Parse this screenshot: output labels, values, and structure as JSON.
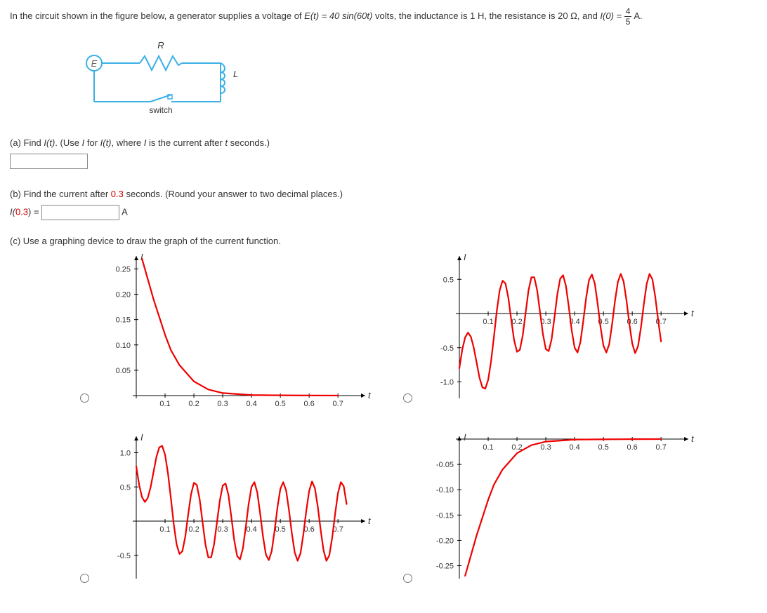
{
  "problem": {
    "intro": "In the circuit shown in the figure below, a generator supplies a voltage of ",
    "voltage_expr_left": "E(t) = 40 sin(60t)",
    "volts_text": " volts,  the inductance is 1 H, the resistance is 20 Ω, and ",
    "i0_lhs": "I(0) = ",
    "frac_num": "4",
    "frac_den": "5",
    "amps_suffix": " A."
  },
  "diagram": {
    "E_label": "E",
    "R_label": "R",
    "L_label": "L",
    "switch_label": "switch"
  },
  "partA": {
    "label": "(a) Find ",
    "var": "I(t)",
    "hint_prefix": ". (Use ",
    "I_word": "I",
    "for_word": " for ",
    "It_word": "I(t)",
    "where_text": ", where ",
    "I_word2": "I",
    "after_text": " is the current after ",
    "t_word": "t",
    "seconds_text": " seconds.)"
  },
  "partB": {
    "label": "(b) Find the current after ",
    "redtime": "0.3",
    "seconds_text": " seconds. (Round your answer to two decimal places.)",
    "I_lhs_pre": "I(",
    "I_lhs_time": "0.3",
    "I_lhs_post": ") = ",
    "unit_suffix": " A"
  },
  "partC": {
    "label": "(c) Use a graphing device to draw the graph of the current function."
  },
  "axis_common": {
    "I_label": "I",
    "t_label": "t"
  },
  "chart_data": [
    {
      "type": "line",
      "title": "",
      "xlabel": "t",
      "ylabel": "I",
      "xlim": [
        0,
        0.78
      ],
      "ylim": [
        0,
        0.27
      ],
      "x_ticks": [
        0.1,
        0.2,
        0.3,
        0.4,
        0.5,
        0.6,
        0.7
      ],
      "y_ticks": [
        0.05,
        0.1,
        0.15,
        0.2,
        0.25
      ],
      "series": [
        {
          "name": "current",
          "x": [
            0.02,
            0.04,
            0.06,
            0.08,
            0.1,
            0.12,
            0.15,
            0.2,
            0.25,
            0.3,
            0.4,
            0.5,
            0.6,
            0.7
          ],
          "y": [
            0.27,
            0.23,
            0.19,
            0.155,
            0.12,
            0.09,
            0.06,
            0.028,
            0.012,
            0.005,
            0.001,
            0.0005,
            0.0002,
            0.0001
          ]
        }
      ]
    },
    {
      "type": "line",
      "title": "",
      "xlabel": "t",
      "ylabel": "I",
      "xlim": [
        0,
        0.78
      ],
      "ylim": [
        -1.2,
        0.8
      ],
      "x_ticks": [
        0.1,
        0.2,
        0.3,
        0.4,
        0.5,
        0.6,
        0.7
      ],
      "y_ticks": [
        -1.0,
        -0.5,
        0.5
      ],
      "series": [
        {
          "name": "current",
          "x": [
            0.0,
            0.01,
            0.02,
            0.03,
            0.04,
            0.05,
            0.06,
            0.07,
            0.08,
            0.09,
            0.1,
            0.11,
            0.12,
            0.13,
            0.14,
            0.15,
            0.16,
            0.17,
            0.18,
            0.19,
            0.2,
            0.21,
            0.22,
            0.23,
            0.24,
            0.25,
            0.26,
            0.27,
            0.28,
            0.29,
            0.3,
            0.31,
            0.32,
            0.33,
            0.34,
            0.35,
            0.36,
            0.37,
            0.38,
            0.39,
            0.4,
            0.41,
            0.42,
            0.43,
            0.44,
            0.45,
            0.46,
            0.47,
            0.48,
            0.49,
            0.5,
            0.51,
            0.52,
            0.53,
            0.54,
            0.55,
            0.56,
            0.57,
            0.58,
            0.59,
            0.6,
            0.61,
            0.62,
            0.63,
            0.64,
            0.65,
            0.66,
            0.67,
            0.68,
            0.69,
            0.7
          ],
          "y": [
            -0.8,
            -0.53,
            -0.35,
            -0.28,
            -0.34,
            -0.5,
            -0.72,
            -0.94,
            -1.08,
            -1.1,
            -0.97,
            -0.7,
            -0.34,
            0.04,
            0.34,
            0.48,
            0.44,
            0.23,
            -0.09,
            -0.39,
            -0.56,
            -0.53,
            -0.32,
            0.01,
            0.34,
            0.53,
            0.53,
            0.34,
            0.02,
            -0.3,
            -0.52,
            -0.55,
            -0.38,
            -0.06,
            0.28,
            0.51,
            0.56,
            0.4,
            0.09,
            -0.25,
            -0.5,
            -0.57,
            -0.42,
            -0.11,
            0.23,
            0.49,
            0.57,
            0.44,
            0.14,
            -0.2,
            -0.47,
            -0.57,
            -0.45,
            -0.16,
            0.18,
            0.46,
            0.58,
            0.47,
            0.19,
            -0.15,
            -0.44,
            -0.58,
            -0.48,
            -0.21,
            0.13,
            0.43,
            0.58,
            0.5,
            0.24,
            -0.1,
            -0.41
          ]
        }
      ]
    },
    {
      "type": "line",
      "title": "",
      "xlabel": "t",
      "ylabel": "I",
      "xlim": [
        0,
        0.78
      ],
      "ylim": [
        -0.8,
        1.2
      ],
      "x_ticks": [
        0.1,
        0.2,
        0.3,
        0.4,
        0.5,
        0.6,
        0.7
      ],
      "y_ticks": [
        -0.5,
        0.5,
        1.0
      ],
      "series": [
        {
          "name": "current",
          "x": [
            0.0,
            0.01,
            0.02,
            0.03,
            0.04,
            0.05,
            0.06,
            0.07,
            0.08,
            0.09,
            0.1,
            0.11,
            0.12,
            0.13,
            0.14,
            0.15,
            0.16,
            0.17,
            0.18,
            0.19,
            0.2,
            0.21,
            0.22,
            0.23,
            0.24,
            0.25,
            0.26,
            0.27,
            0.28,
            0.29,
            0.3,
            0.31,
            0.32,
            0.33,
            0.34,
            0.35,
            0.36,
            0.37,
            0.38,
            0.39,
            0.4,
            0.41,
            0.42,
            0.43,
            0.44,
            0.45,
            0.46,
            0.47,
            0.48,
            0.49,
            0.5,
            0.51,
            0.52,
            0.53,
            0.54,
            0.55,
            0.56,
            0.57,
            0.58,
            0.59,
            0.6,
            0.61,
            0.62,
            0.63,
            0.64,
            0.65,
            0.66,
            0.67,
            0.68,
            0.69,
            0.7,
            0.71,
            0.72,
            0.73
          ],
          "y": [
            0.8,
            0.53,
            0.35,
            0.28,
            0.34,
            0.5,
            0.72,
            0.94,
            1.08,
            1.1,
            0.97,
            0.7,
            0.34,
            -0.04,
            -0.34,
            -0.48,
            -0.44,
            -0.23,
            0.09,
            0.39,
            0.56,
            0.53,
            0.32,
            -0.01,
            -0.34,
            -0.53,
            -0.53,
            -0.34,
            -0.02,
            0.3,
            0.52,
            0.55,
            0.38,
            0.06,
            -0.28,
            -0.51,
            -0.56,
            -0.4,
            -0.09,
            0.25,
            0.5,
            0.57,
            0.42,
            0.11,
            -0.23,
            -0.49,
            -0.57,
            -0.44,
            -0.14,
            0.2,
            0.47,
            0.57,
            0.45,
            0.16,
            -0.18,
            -0.46,
            -0.58,
            -0.47,
            -0.19,
            0.15,
            0.44,
            0.58,
            0.48,
            0.21,
            -0.13,
            -0.43,
            -0.58,
            -0.5,
            -0.24,
            0.1,
            0.41,
            0.57,
            0.51,
            0.25
          ]
        }
      ]
    },
    {
      "type": "line",
      "title": "",
      "xlabel": "t",
      "ylabel": "I",
      "xlim": [
        0,
        0.78
      ],
      "ylim": [
        -0.27,
        0.0
      ],
      "x_ticks": [
        0.1,
        0.2,
        0.3,
        0.4,
        0.5,
        0.6,
        0.7
      ],
      "y_ticks": [
        -0.25,
        -0.2,
        -0.15,
        -0.1,
        -0.05
      ],
      "series": [
        {
          "name": "current",
          "x": [
            0.02,
            0.04,
            0.06,
            0.08,
            0.1,
            0.12,
            0.15,
            0.2,
            0.25,
            0.3,
            0.4,
            0.5,
            0.6,
            0.7
          ],
          "y": [
            -0.27,
            -0.23,
            -0.19,
            -0.155,
            -0.12,
            -0.09,
            -0.06,
            -0.028,
            -0.012,
            -0.005,
            -0.001,
            -0.0005,
            -0.0002,
            -0.0001
          ]
        }
      ]
    }
  ]
}
